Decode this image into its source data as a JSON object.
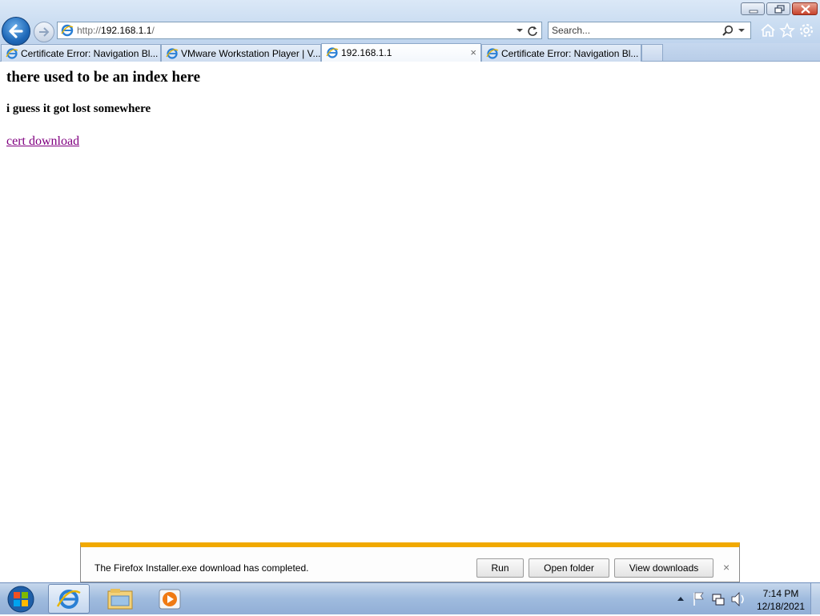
{
  "browser": {
    "address": {
      "prefix": "http://",
      "host": "192.168.1.1",
      "suffix": "/"
    },
    "search": {
      "placeholder": "Search..."
    },
    "tabs": [
      {
        "label": "Certificate Error: Navigation Bl...",
        "active": false
      },
      {
        "label": "VMware Workstation Player | V...",
        "active": false
      },
      {
        "label": "192.168.1.1",
        "active": true,
        "close": "×"
      },
      {
        "label": "Certificate Error: Navigation Bl...",
        "active": false
      }
    ]
  },
  "page": {
    "heading": "there used to be an index here",
    "subheading": "i guess it got lost somewhere",
    "link_text": "cert download"
  },
  "download_bar": {
    "message": "The Firefox Installer.exe download has completed.",
    "run_label": "Run",
    "open_folder_label": "Open folder",
    "view_downloads_label": "View downloads",
    "close": "×"
  },
  "taskbar": {
    "time": "7:14 PM",
    "date": "12/18/2021"
  },
  "colors": {
    "visited_link": "#800080",
    "download_accent": "#f1a900"
  }
}
